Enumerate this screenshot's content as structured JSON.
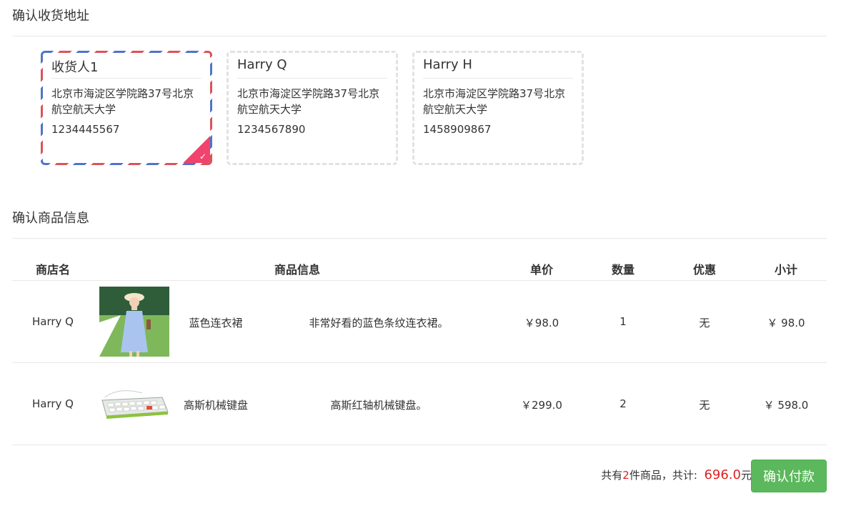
{
  "address_section": {
    "title": "确认收货地址",
    "addresses": [
      {
        "name": "收货人1",
        "address": "北京市海淀区学院路37号北京航空航天大学",
        "phone": "1234445567",
        "selected": true
      },
      {
        "name": "Harry Q",
        "address": "北京市海淀区学院路37号北京航空航天大学",
        "phone": "1234567890",
        "selected": false
      },
      {
        "name": "Harry H",
        "address": "北京市海淀区学院路37号北京航空航天大学",
        "phone": "1458909867",
        "selected": false
      }
    ]
  },
  "goods_section": {
    "title": "确认商品信息",
    "headers": {
      "shop": "商店名",
      "info": "商品信息",
      "price": "单价",
      "qty": "数量",
      "discount": "优惠",
      "subtotal": "小计"
    },
    "rows": [
      {
        "shop": "Harry Q",
        "image": "dress-photo",
        "name": "蓝色连衣裙",
        "desc": "非常好看的蓝色条纹连衣裙。",
        "price": "￥98.0",
        "qty": "1",
        "discount": "无",
        "subtotal": "￥ 98.0"
      },
      {
        "shop": "Harry Q",
        "image": "keyboard-photo",
        "name": "高斯机械键盘",
        "desc": "高斯红轴机械键盘。",
        "price": "￥299.0",
        "qty": "2",
        "discount": "无",
        "subtotal": "￥ 598.0"
      }
    ]
  },
  "footer": {
    "summary_prefix": "共有",
    "item_count": "2",
    "summary_middle": "件商品，共计:",
    "total": "696.0",
    "currency_unit": "元",
    "pay_button": "确认付款"
  },
  "colors": {
    "accent_red": "#e02020",
    "pay_green": "#5cb85c",
    "check_pink": "#f0436d"
  }
}
